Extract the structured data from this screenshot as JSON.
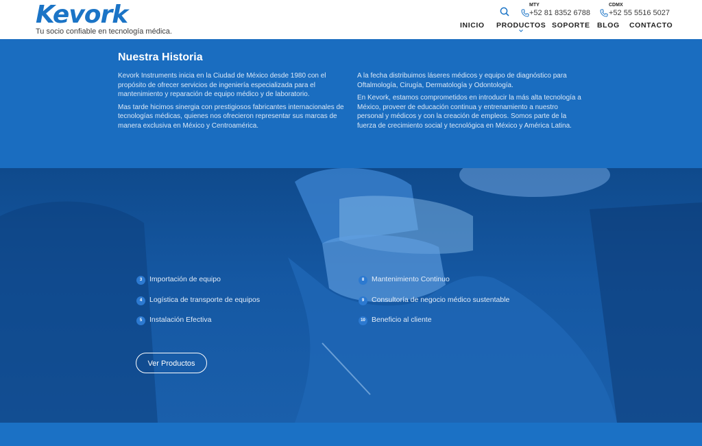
{
  "header": {
    "logo_text": "Kevork",
    "tagline": "Tu socio confiable en tecnología médica.",
    "search_icon": "search-icon",
    "phones": [
      {
        "city": "MTY",
        "number": "+52 81 8352 6788",
        "icon": "phone-icon"
      },
      {
        "city": "CDMX",
        "number": "+52 55 5516 5027",
        "icon": "phone-icon"
      }
    ],
    "nav": [
      {
        "label": "INICIO"
      },
      {
        "label": "PRODUCTOS",
        "has_dropdown": true
      },
      {
        "label": "SOPORTE"
      },
      {
        "label": "BLOG"
      },
      {
        "label": "CONTACTO"
      }
    ]
  },
  "history": {
    "title": "Nuestra Historia",
    "col1": [
      "Kevork Instruments inicia en la Ciudad de México desde 1980 con el propósito de ofrecer servicios de ingeniería especializada para el mantenimiento y reparación de equipo médico y de laboratorio.",
      "Mas tarde hicimos sinergia con prestigiosos fabricantes internacionales de tecnologías médicas, quienes nos ofrecieron representar sus marcas de manera exclusiva en México y Centroamérica."
    ],
    "col2": [
      "A la fecha distribuimos láseres médicos y equipo de diagnóstico para Oftalmología, Cirugía, Dermatología y Odontología.",
      "En Kevork, estamos comprometidos en introducir la más alta tecnología a México, proveer de educación continua y entrenamiento a nuestro personal y médicos y con la creación de empleos. Somos parte de la fuerza de crecimiento social y tecnológica en México y América Latina."
    ]
  },
  "features": {
    "left": [
      {
        "num": "3",
        "label": "Importación de equipo"
      },
      {
        "num": "4",
        "label": "Logística de transporte de equipos"
      },
      {
        "num": "5",
        "label": "Instalación Efectiva"
      }
    ],
    "right": [
      {
        "num": "8",
        "label": "Mantenimiento Continuo"
      },
      {
        "num": "9",
        "label": "Consultoría de negocio médico sustentable"
      },
      {
        "num": "10",
        "label": "Beneficio al cliente"
      }
    ]
  },
  "cta": {
    "label": "Ver Productos"
  },
  "colors": {
    "brand": "#1b74c6",
    "section_blue": "#1a6dc0",
    "hero_blue": "#1558a3"
  }
}
